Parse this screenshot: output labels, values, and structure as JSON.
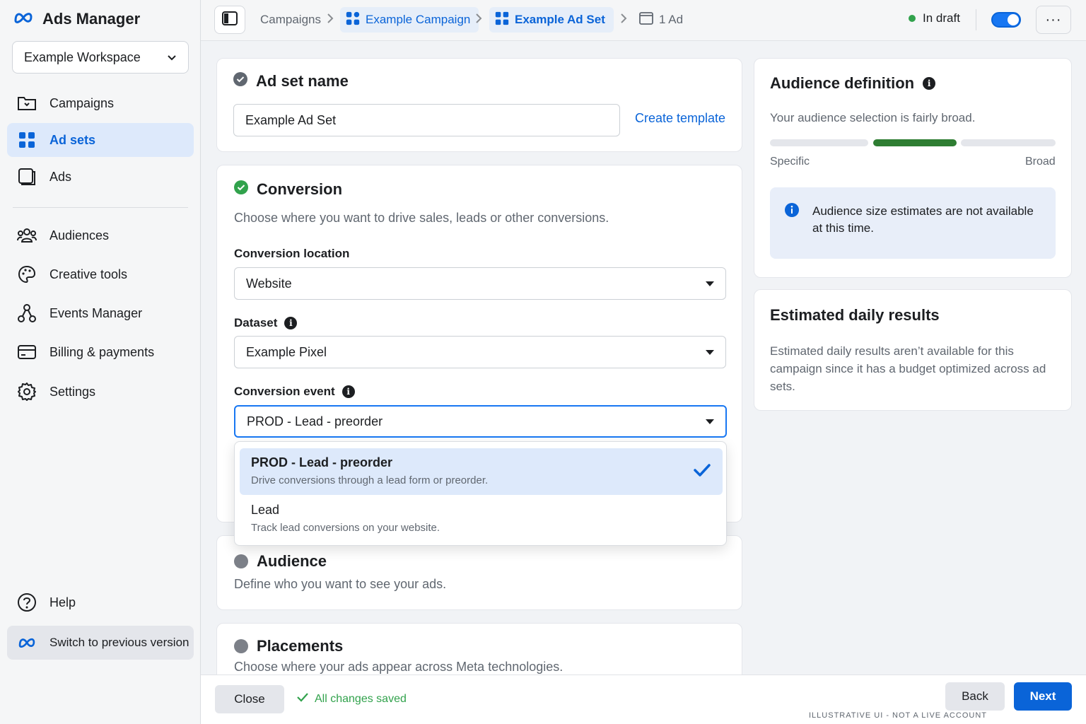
{
  "app": {
    "title": "Ads Manager",
    "workspace": "Example Workspace"
  },
  "sidebar": {
    "items": [
      {
        "label": "Campaigns",
        "icon": "folder-icon"
      },
      {
        "label": "Ad sets",
        "icon": "grid-icon",
        "active": true
      },
      {
        "label": "Ads",
        "icon": "ad-icon"
      },
      {
        "label": "Audiences",
        "icon": "people-icon"
      },
      {
        "label": "Creative tools",
        "icon": "palette-icon"
      },
      {
        "label": "Events Manager",
        "icon": "events-icon"
      },
      {
        "label": "Billing & payments",
        "icon": "card-icon"
      },
      {
        "label": "Settings",
        "icon": "gear-icon"
      }
    ],
    "help": "Help",
    "switch_version": "Switch to previous version"
  },
  "breadcrumb": {
    "campaigns": "Campaigns",
    "campaign": "Example Campaign",
    "ad_set": "Example Ad Set",
    "ad": "1 Ad"
  },
  "topbar": {
    "status": "In draft",
    "more": "···"
  },
  "adset_name": {
    "title": "Ad set name",
    "value": "Example Ad Set",
    "create_template": "Create template"
  },
  "conversion": {
    "title": "Conversion",
    "description": "Choose where you want to drive sales, leads or other conversions.",
    "location_label": "Conversion location",
    "location_value": "Website",
    "dataset_label": "Dataset",
    "dataset_value": "Example Pixel",
    "event_label": "Conversion event",
    "event_value": "PROD - Lead - preorder",
    "options": [
      {
        "title": "PROD - Lead - preorder",
        "desc": "Drive conversions through a lead form or preorder.",
        "selected": true
      },
      {
        "title": "Lead",
        "desc": "Track lead conversions on your website.",
        "selected": false
      }
    ]
  },
  "audience": {
    "title": "Audience",
    "description": "Define who you want to see your ads."
  },
  "placements": {
    "title": "Placements",
    "description": "Choose where your ads appear across Meta technologies."
  },
  "audience_definition": {
    "title": "Audience definition",
    "summary": "Your audience selection is fairly broad.",
    "specific": "Specific",
    "broad": "Broad",
    "notice": "Audience size estimates are not available at this time."
  },
  "estimated": {
    "title": "Estimated daily results",
    "text": "Estimated daily results aren’t available for this campaign since it has a budget optimized across ad sets."
  },
  "footer": {
    "close": "Close",
    "saved": "All changes saved",
    "back": "Back",
    "next": "Next",
    "watermark": "ILLUSTRATIVE UI - NOT A LIVE ACCOUNT"
  },
  "colors": {
    "accent": "#0a64d8",
    "success": "#31a24c",
    "meter_active": "#2e7d32"
  }
}
